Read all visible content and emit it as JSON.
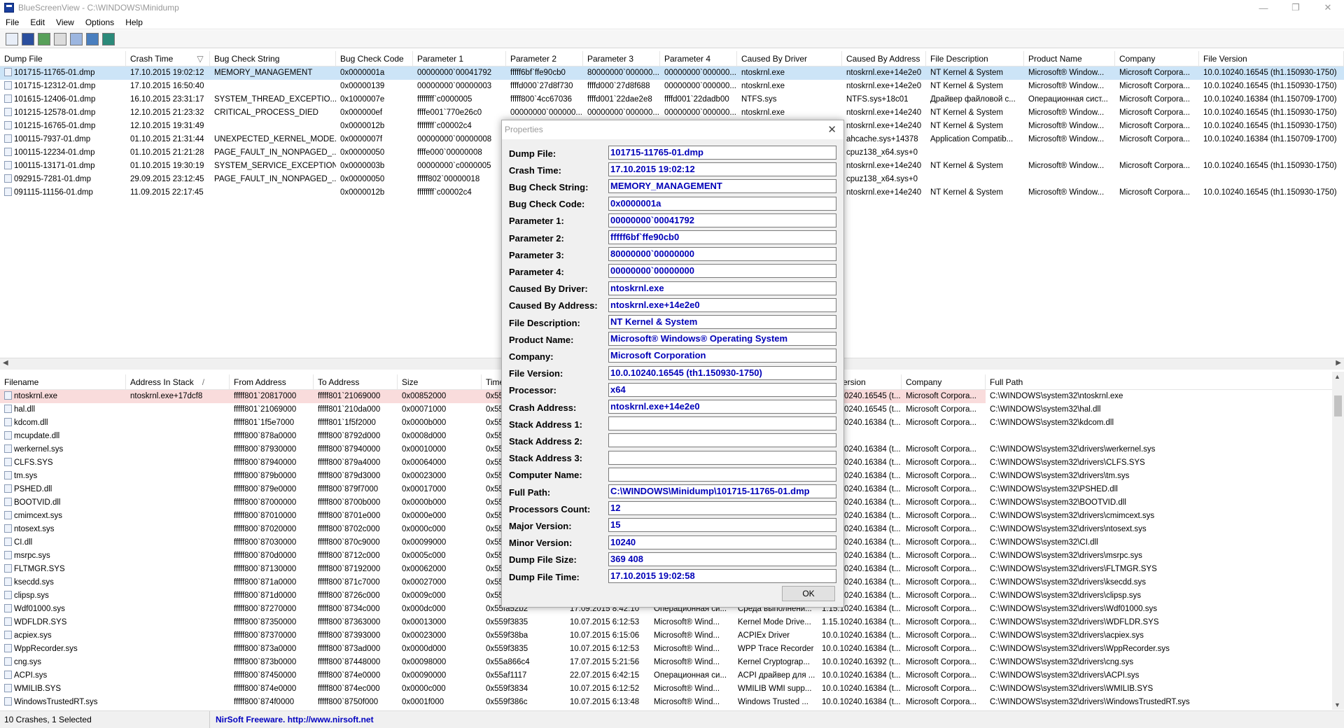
{
  "window": {
    "title": "BlueScreenView - C:\\WINDOWS\\Minidump",
    "min": "—",
    "restore": "❐",
    "close": "✕"
  },
  "menu": [
    "File",
    "Edit",
    "View",
    "Options",
    "Help"
  ],
  "toolbar_icons": [
    "properties-icon",
    "save-icon",
    "refresh-icon",
    "copy-icon",
    "options-icon",
    "find-icon",
    "exit-icon"
  ],
  "top_columns": [
    {
      "label": "Dump File",
      "w": 180
    },
    {
      "label": "Crash Time",
      "w": 120
    },
    {
      "label": "Bug Check String",
      "w": 180
    },
    {
      "label": "Bug Check Code",
      "w": 110
    },
    {
      "label": "Parameter 1",
      "w": 133
    },
    {
      "label": "Parameter 2",
      "w": 110
    },
    {
      "label": "Parameter 3",
      "w": 110
    },
    {
      "label": "Parameter 4",
      "w": 110
    },
    {
      "label": "Caused By Driver",
      "w": 150
    },
    {
      "label": "Caused By Address",
      "w": 120
    },
    {
      "label": "File Description",
      "w": 140
    },
    {
      "label": "Product Name",
      "w": 130
    },
    {
      "label": "Company",
      "w": 120
    },
    {
      "label": "File Version",
      "w": 207
    }
  ],
  "top_sort_indicator": "▽",
  "crashes": [
    [
      "101715-11765-01.dmp",
      "17.10.2015 19:02:12",
      "MEMORY_MANAGEMENT",
      "0x0000001a",
      "00000000`00041792",
      "fffff6bf`ffe90cb0",
      "80000000`000000...",
      "00000000`000000...",
      "ntoskrnl.exe",
      "ntoskrnl.exe+14e2e0",
      "NT Kernel & System",
      "Microsoft® Window...",
      "Microsoft Corpora...",
      "10.0.10240.16545 (th1.150930-1750)"
    ],
    [
      "101715-12312-01.dmp",
      "17.10.2015 16:50:40",
      "",
      "0x00000139",
      "00000000`00000003",
      "ffffd000`27d8f730",
      "ffffd000`27d8f688",
      "00000000`000000...",
      "ntoskrnl.exe",
      "ntoskrnl.exe+14e2e0",
      "NT Kernel & System",
      "Microsoft® Window...",
      "Microsoft Corpora...",
      "10.0.10240.16545 (th1.150930-1750)"
    ],
    [
      "101615-12406-01.dmp",
      "16.10.2015 23:31:17",
      "SYSTEM_THREAD_EXCEPTIO...",
      "0x1000007e",
      "ffffffff`c0000005",
      "fffff800`4cc67036",
      "ffffd001`22dae2e8",
      "ffffd001`22dadb00",
      "NTFS.sys",
      "NTFS.sys+18c01",
      "Драйвер файловой с...",
      "Операционная сист...",
      "Microsoft Corpora...",
      "10.0.10240.16384 (th1.150709-1700)"
    ],
    [
      "101215-12578-01.dmp",
      "12.10.2015 21:23:32",
      "CRITICAL_PROCESS_DIED",
      "0x000000ef",
      "ffffe001`770e26c0",
      "00000000`000000...",
      "00000000`000000...",
      "00000000`000000...",
      "ntoskrnl.exe",
      "ntoskrnl.exe+14e240",
      "NT Kernel & System",
      "Microsoft® Window...",
      "Microsoft Corpora...",
      "10.0.10240.16545 (th1.150930-1750)"
    ],
    [
      "101215-16765-01.dmp",
      "12.10.2015 19:31:49",
      "",
      "0x0000012b",
      "ffffffff`c00002c4",
      "",
      "",
      "",
      "",
      "ntoskrnl.exe+14e240",
      "NT Kernel & System",
      "Microsoft® Window...",
      "Microsoft Corpora...",
      "10.0.10240.16545 (th1.150930-1750)"
    ],
    [
      "100115-7937-01.dmp",
      "01.10.2015 21:31:44",
      "UNEXPECTED_KERNEL_MODE...",
      "0x0000007f",
      "00000000`00000008",
      "",
      "",
      "",
      "",
      "ahcache.sys+14378",
      "Application Compatib...",
      "Microsoft® Window...",
      "Microsoft Corpora...",
      "10.0.10240.16384 (th1.150709-1700)"
    ],
    [
      "100115-12234-01.dmp",
      "01.10.2015 21:21:28",
      "PAGE_FAULT_IN_NONPAGED_...",
      "0x00000050",
      "ffffe000`00000008",
      "",
      "",
      "",
      "",
      "cpuz138_x64.sys+0",
      "",
      "",
      "",
      ""
    ],
    [
      "100115-13171-01.dmp",
      "01.10.2015 19:30:19",
      "SYSTEM_SERVICE_EXCEPTION",
      "0x0000003b",
      "00000000`c0000005",
      "",
      "",
      "",
      "",
      "ntoskrnl.exe+14e240",
      "NT Kernel & System",
      "Microsoft® Window...",
      "Microsoft Corpora...",
      "10.0.10240.16545 (th1.150930-1750)"
    ],
    [
      "092915-7281-01.dmp",
      "29.09.2015 23:12:45",
      "PAGE_FAULT_IN_NONPAGED_...",
      "0x00000050",
      "fffff802`00000018",
      "",
      "",
      "",
      "",
      "cpuz138_x64.sys+0",
      "",
      "",
      "",
      ""
    ],
    [
      "091115-11156-01.dmp",
      "11.09.2015 22:17:45",
      "",
      "0x0000012b",
      "ffffffff`c00002c4",
      "",
      "",
      "",
      "",
      "ntoskrnl.exe+14e240",
      "NT Kernel & System",
      "Microsoft® Window...",
      "Microsoft Corpora...",
      "10.0.10240.16545 (th1.150930-1750)"
    ]
  ],
  "bottom_columns": [
    {
      "label": "Filename",
      "w": 180
    },
    {
      "label": "Address In Stack",
      "w": 148
    },
    {
      "label": "From Address",
      "w": 120
    },
    {
      "label": "To Address",
      "w": 120
    },
    {
      "label": "Size",
      "w": 120
    },
    {
      "label": "Time Stamp",
      "w": 120
    },
    {
      "label": "Time String",
      "w": 120
    },
    {
      "label": "Product Name",
      "w": 120
    },
    {
      "label": "File Description",
      "w": 120
    },
    {
      "label": "File Version",
      "w": 120
    },
    {
      "label": "Company",
      "w": 120
    },
    {
      "label": "Full Path",
      "w": 512
    }
  ],
  "bottom_sort_indicator": "/",
  "drivers": [
    [
      "ntoskrnl.exe",
      "ntoskrnl.exe+17dcf8",
      "fffff801`20817000",
      "fffff801`21069000",
      "0x00852000",
      "0x55f...",
      "",
      "",
      "",
      "10.0.10240.16545 (t...",
      "Microsoft Corpora...",
      "C:\\WINDOWS\\system32\\ntoskrnl.exe"
    ],
    [
      "hal.dll",
      "",
      "fffff801`21069000",
      "fffff801`210da000",
      "0x00071000",
      "0x55...",
      "",
      "",
      "",
      "10.0.10240.16545 (t...",
      "Microsoft Corpora...",
      "C:\\WINDOWS\\system32\\hal.dll"
    ],
    [
      "kdcom.dll",
      "",
      "fffff801`1f5e7000",
      "fffff801`1f5f2000",
      "0x0000b000",
      "0x55...",
      "",
      "",
      "",
      "10.0.10240.16384 (t...",
      "Microsoft Corpora...",
      "C:\\WINDOWS\\system32\\kdcom.dll"
    ],
    [
      "mcupdate.dll",
      "",
      "fffff800`878a0000",
      "fffff800`8792d000",
      "0x0008d000",
      "0x55...",
      "",
      "",
      "",
      "",
      "",
      ""
    ],
    [
      "werkernel.sys",
      "",
      "fffff800`87930000",
      "fffff800`87940000",
      "0x00010000",
      "0x55...",
      "",
      "",
      "",
      "10.0.10240.16384 (t...",
      "Microsoft Corpora...",
      "C:\\WINDOWS\\system32\\drivers\\werkernel.sys"
    ],
    [
      "CLFS.SYS",
      "",
      "fffff800`87940000",
      "fffff800`879a4000",
      "0x00064000",
      "0x55...",
      "",
      "",
      "",
      "10.0.10240.16384 (t...",
      "Microsoft Corpora...",
      "C:\\WINDOWS\\system32\\drivers\\CLFS.SYS"
    ],
    [
      "tm.sys",
      "",
      "fffff800`879b0000",
      "fffff800`879d3000",
      "0x00023000",
      "0x55...",
      "",
      "",
      "",
      "10.0.10240.16384 (t...",
      "Microsoft Corpora...",
      "C:\\WINDOWS\\system32\\drivers\\tm.sys"
    ],
    [
      "PSHED.dll",
      "",
      "fffff800`879e0000",
      "fffff800`879f7000",
      "0x00017000",
      "0x55...",
      "",
      "",
      "",
      "10.0.10240.16384 (t...",
      "Microsoft Corpora...",
      "C:\\WINDOWS\\system32\\PSHED.dll"
    ],
    [
      "BOOTVID.dll",
      "",
      "fffff800`87000000",
      "fffff800`8700b000",
      "0x0000b000",
      "0x55...",
      "",
      "",
      "",
      "10.0.10240.16384 (t...",
      "Microsoft Corpora...",
      "C:\\WINDOWS\\system32\\BOOTVID.dll"
    ],
    [
      "cmimcext.sys",
      "",
      "fffff800`87010000",
      "fffff800`8701e000",
      "0x0000e000",
      "0x55...",
      "",
      "",
      "",
      "10.0.10240.16384 (t...",
      "Microsoft Corpora...",
      "C:\\WINDOWS\\system32\\drivers\\cmimcext.sys"
    ],
    [
      "ntosext.sys",
      "",
      "fffff800`87020000",
      "fffff800`8702c000",
      "0x0000c000",
      "0x55...",
      "",
      "",
      "",
      "10.0.10240.16384 (t...",
      "Microsoft Corpora...",
      "C:\\WINDOWS\\system32\\drivers\\ntosext.sys"
    ],
    [
      "CI.dll",
      "",
      "fffff800`87030000",
      "fffff800`870c9000",
      "0x00099000",
      "0x55...",
      "",
      "",
      "",
      "10.0.10240.16384 (t...",
      "Microsoft Corpora...",
      "C:\\WINDOWS\\system32\\CI.dll"
    ],
    [
      "msrpc.sys",
      "",
      "fffff800`870d0000",
      "fffff800`8712c000",
      "0x0005c000",
      "0x55...",
      "",
      "",
      "",
      "10.0.10240.16384 (t...",
      "Microsoft Corpora...",
      "C:\\WINDOWS\\system32\\drivers\\msrpc.sys"
    ],
    [
      "FLTMGR.SYS",
      "",
      "fffff800`87130000",
      "fffff800`87192000",
      "0x00062000",
      "0x55...",
      "",
      "",
      "",
      "10.0.10240.16384 (t...",
      "Microsoft Corpora...",
      "C:\\WINDOWS\\system32\\drivers\\FLTMGR.SYS"
    ],
    [
      "ksecdd.sys",
      "",
      "fffff800`871a0000",
      "fffff800`871c7000",
      "0x00027000",
      "0x55...",
      "",
      "",
      "",
      "10.0.10240.16384 (t...",
      "Microsoft Corpora...",
      "C:\\WINDOWS\\system32\\drivers\\ksecdd.sys"
    ],
    [
      "clipsp.sys",
      "",
      "fffff800`871d0000",
      "fffff800`8726c000",
      "0x0009c000",
      "0x55...",
      "",
      "",
      "",
      "10.0.10240.16384 (t...",
      "Microsoft Corpora...",
      "C:\\WINDOWS\\system32\\drivers\\clipsp.sys"
    ],
    [
      "Wdf01000.sys",
      "",
      "fffff800`87270000",
      "fffff800`8734c000",
      "0x000dc000",
      "0x55fa52b2",
      "17.09.2015 8:42:10",
      "Операционная си...",
      "Среда выполнени...",
      "1.15.10240.16384 (t...",
      "Microsoft Corpora...",
      "C:\\WINDOWS\\system32\\drivers\\Wdf01000.sys"
    ],
    [
      "WDFLDR.SYS",
      "",
      "fffff800`87350000",
      "fffff800`87363000",
      "0x00013000",
      "0x559f3835",
      "10.07.2015 6:12:53",
      "Microsoft® Wind...",
      "Kernel Mode Drive...",
      "1.15.10240.16384 (t...",
      "Microsoft Corpora...",
      "C:\\WINDOWS\\system32\\drivers\\WDFLDR.SYS"
    ],
    [
      "acpiex.sys",
      "",
      "fffff800`87370000",
      "fffff800`87393000",
      "0x00023000",
      "0x559f38ba",
      "10.07.2015 6:15:06",
      "Microsoft® Wind...",
      "ACPIEx Driver",
      "10.0.10240.16384 (t...",
      "Microsoft Corpora...",
      "C:\\WINDOWS\\system32\\drivers\\acpiex.sys"
    ],
    [
      "WppRecorder.sys",
      "",
      "fffff800`873a0000",
      "fffff800`873ad000",
      "0x0000d000",
      "0x559f3835",
      "10.07.2015 6:12:53",
      "Microsoft® Wind...",
      "WPP Trace Recorder",
      "10.0.10240.16384 (t...",
      "Microsoft Corpora...",
      "C:\\WINDOWS\\system32\\drivers\\WppRecorder.sys"
    ],
    [
      "cng.sys",
      "",
      "fffff800`873b0000",
      "fffff800`87448000",
      "0x00098000",
      "0x55a866c4",
      "17.07.2015 5:21:56",
      "Microsoft® Wind...",
      "Kernel Cryptograp...",
      "10.0.10240.16392 (t...",
      "Microsoft Corpora...",
      "C:\\WINDOWS\\system32\\drivers\\cng.sys"
    ],
    [
      "ACPI.sys",
      "",
      "fffff800`87450000",
      "fffff800`874e0000",
      "0x00090000",
      "0x55af1117",
      "22.07.2015 6:42:15",
      "Операционная си...",
      "ACPI драйвер для ...",
      "10.0.10240.16384 (t...",
      "Microsoft Corpora...",
      "C:\\WINDOWS\\system32\\drivers\\ACPI.sys"
    ],
    [
      "WMILIB.SYS",
      "",
      "fffff800`874e0000",
      "fffff800`874ec000",
      "0x0000c000",
      "0x559f3834",
      "10.07.2015 6:12:52",
      "Microsoft® Wind...",
      "WMILIB WMI supp...",
      "10.0.10240.16384 (t...",
      "Microsoft Corpora...",
      "C:\\WINDOWS\\system32\\drivers\\WMILIB.SYS"
    ],
    [
      "WindowsTrustedRT.sys",
      "",
      "fffff800`874f0000",
      "fffff800`8750f000",
      "0x0001f000",
      "0x559f386c",
      "10.07.2015 6:13:48",
      "Microsoft® Wind...",
      "Windows Trusted ...",
      "10.0.10240.16384 (t...",
      "Microsoft Corpora...",
      "C:\\WINDOWS\\system32\\drivers\\WindowsTrustedRT.sys"
    ]
  ],
  "status": {
    "count": "10 Crashes, 1 Selected",
    "link": "NirSoft Freeware.  http://www.nirsoft.net"
  },
  "dialog": {
    "title": "Properties",
    "close": "✕",
    "ok": "OK",
    "props": [
      {
        "label": "Dump File:",
        "value": "101715-11765-01.dmp"
      },
      {
        "label": "Crash Time:",
        "value": "17.10.2015 19:02:12"
      },
      {
        "label": "Bug Check String:",
        "value": "MEMORY_MANAGEMENT"
      },
      {
        "label": "Bug Check Code:",
        "value": "0x0000001a"
      },
      {
        "label": "Parameter 1:",
        "value": "00000000`00041792"
      },
      {
        "label": "Parameter 2:",
        "value": "fffff6bf`ffe90cb0"
      },
      {
        "label": "Parameter 3:",
        "value": "80000000`00000000"
      },
      {
        "label": "Parameter 4:",
        "value": "00000000`00000000"
      },
      {
        "label": "Caused By Driver:",
        "value": "ntoskrnl.exe"
      },
      {
        "label": "Caused By Address:",
        "value": "ntoskrnl.exe+14e2e0"
      },
      {
        "label": "File Description:",
        "value": "NT Kernel & System"
      },
      {
        "label": "Product Name:",
        "value": "Microsoft® Windows® Operating System"
      },
      {
        "label": "Company:",
        "value": "Microsoft Corporation"
      },
      {
        "label": "File Version:",
        "value": "10.0.10240.16545 (th1.150930-1750)"
      },
      {
        "label": "Processor:",
        "value": "x64"
      },
      {
        "label": "Crash Address:",
        "value": "ntoskrnl.exe+14e2e0"
      },
      {
        "label": "Stack Address 1:",
        "value": ""
      },
      {
        "label": "Stack Address 2:",
        "value": ""
      },
      {
        "label": "Stack Address 3:",
        "value": ""
      },
      {
        "label": "Computer Name:",
        "value": ""
      },
      {
        "label": "Full Path:",
        "value": "C:\\WINDOWS\\Minidump\\101715-11765-01.dmp"
      },
      {
        "label": "Processors Count:",
        "value": "12"
      },
      {
        "label": "Major Version:",
        "value": "15"
      },
      {
        "label": "Minor Version:",
        "value": "10240"
      },
      {
        "label": "Dump File Size:",
        "value": "369 408"
      },
      {
        "label": "Dump File Time:",
        "value": "17.10.2015 19:02:58"
      }
    ]
  },
  "colors": {
    "selected_row": "#cce4f7",
    "driver_highlight": "#f9dcdc",
    "value_text": "#0000b8",
    "link": "#0000c0"
  }
}
